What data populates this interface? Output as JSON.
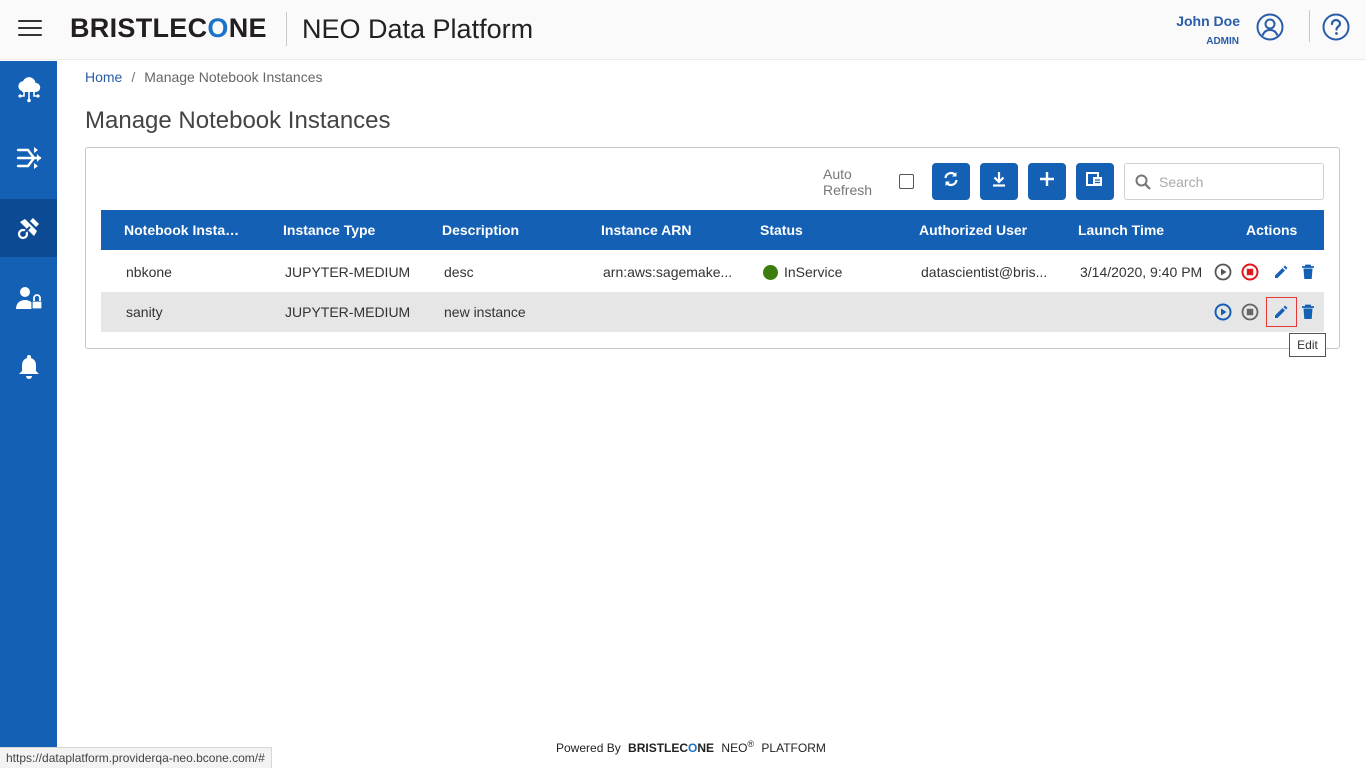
{
  "header": {
    "logo_text_a": "BRISTLEC",
    "logo_text_b": "NE",
    "logo_o": "O",
    "app_title": "NEO Data Platform",
    "user_name": "John Doe",
    "user_role": "ADMIN"
  },
  "sidebar": {
    "items": [
      {
        "icon": "cloud-network-icon",
        "active": false
      },
      {
        "icon": "pipeline-icon",
        "active": false
      },
      {
        "icon": "notebook-tools-icon",
        "active": true
      },
      {
        "icon": "user-lock-icon",
        "active": false
      },
      {
        "icon": "bell-icon",
        "active": false
      }
    ]
  },
  "breadcrumb": {
    "home": "Home",
    "separator": "/",
    "current": "Manage Notebook Instances"
  },
  "page_title": "Manage Notebook Instances",
  "toolbar": {
    "auto_refresh_line1": "Auto",
    "auto_refresh_line2": "Refresh",
    "auto_refresh_checked": false,
    "buttons": [
      "refresh-icon",
      "download-icon",
      "add-icon",
      "export-icon"
    ],
    "search_placeholder": "Search"
  },
  "table": {
    "columns": [
      "Notebook Instan...",
      "Instance Type",
      "Description",
      "Instance ARN",
      "Status",
      "Authorized User",
      "Launch Time",
      "Actions"
    ],
    "rows": [
      {
        "name": "nbkone",
        "type": "JUPYTER-MEDIUM",
        "description": "desc",
        "arn": "arn:aws:sagemake...",
        "status": "InService",
        "user": "datascientist@bris...",
        "launch_time": "3/14/2020, 9:40 PM"
      },
      {
        "name": "sanity",
        "type": "JUPYTER-MEDIUM",
        "description": "new instance",
        "arn": "",
        "status": "",
        "user": "",
        "launch_time": ""
      }
    ]
  },
  "tooltip": "Edit",
  "footer": {
    "powered_by": "Powered By",
    "brand_a": "BRISTLEC",
    "brand_o": "O",
    "brand_b": "NE",
    "neo": "NEO",
    "reg": "®",
    "platform": "PLATFORM"
  },
  "status_bar_url": "https://dataplatform.providerqa-neo.bcone.com/#",
  "colors": {
    "brand_blue": "#1460b4",
    "status_green": "#3d7d0d",
    "stop_red": "#e0181b"
  }
}
